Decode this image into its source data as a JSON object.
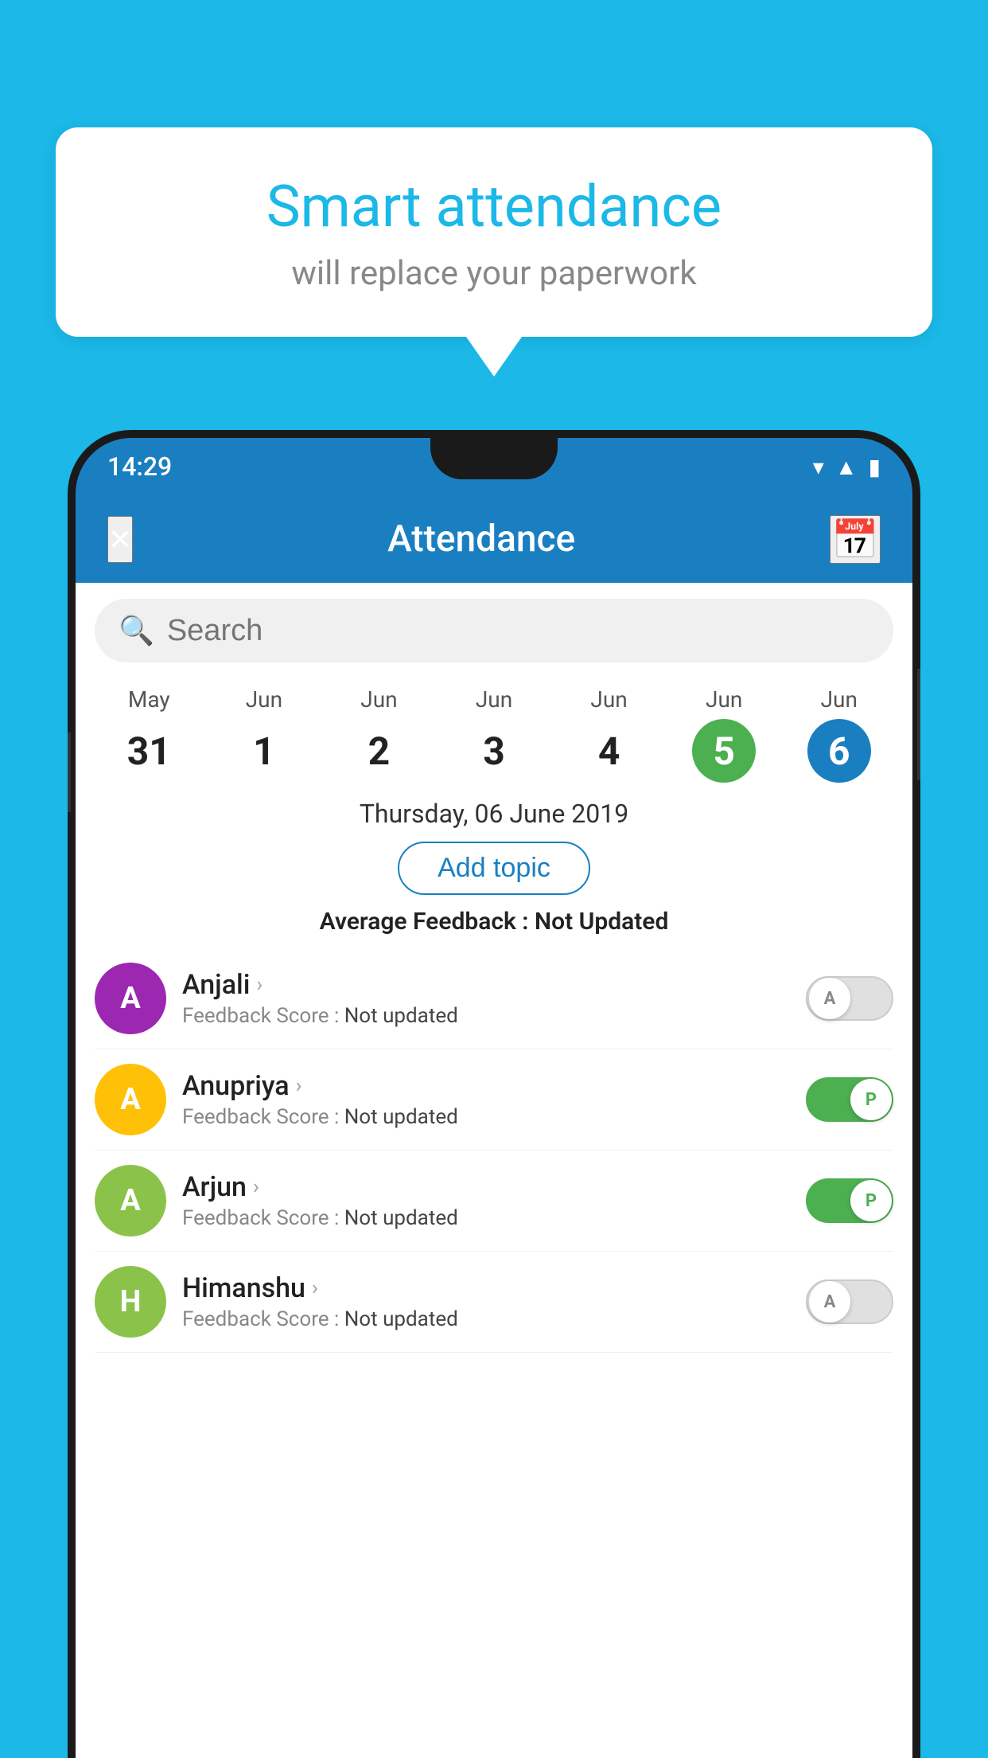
{
  "background_color": "#1bb8e8",
  "speech_bubble": {
    "title": "Smart attendance",
    "subtitle": "will replace your paperwork"
  },
  "status_bar": {
    "time": "14:29",
    "icons": [
      "wifi",
      "signal",
      "battery"
    ]
  },
  "app_bar": {
    "title": "Attendance",
    "close_label": "×",
    "calendar_label": "📅"
  },
  "search": {
    "placeholder": "Search"
  },
  "calendar": {
    "days": [
      {
        "month": "May",
        "date": "31",
        "state": "normal"
      },
      {
        "month": "Jun",
        "date": "1",
        "state": "normal"
      },
      {
        "month": "Jun",
        "date": "2",
        "state": "normal"
      },
      {
        "month": "Jun",
        "date": "3",
        "state": "normal"
      },
      {
        "month": "Jun",
        "date": "4",
        "state": "normal"
      },
      {
        "month": "Jun",
        "date": "5",
        "state": "today"
      },
      {
        "month": "Jun",
        "date": "6",
        "state": "selected"
      }
    ],
    "selected_date_label": "Thursday, 06 June 2019"
  },
  "add_topic_btn": "Add topic",
  "avg_feedback_label": "Average Feedback :",
  "avg_feedback_value": "Not Updated",
  "students": [
    {
      "name": "Anjali",
      "avatar_letter": "A",
      "avatar_color": "#9c27b0",
      "feedback_label": "Feedback Score :",
      "feedback_value": "Not updated",
      "toggle": "off",
      "toggle_letter": "A"
    },
    {
      "name": "Anupriya",
      "avatar_letter": "A",
      "avatar_color": "#ffc107",
      "feedback_label": "Feedback Score :",
      "feedback_value": "Not updated",
      "toggle": "on",
      "toggle_letter": "P"
    },
    {
      "name": "Arjun",
      "avatar_letter": "A",
      "avatar_color": "#8bc34a",
      "feedback_label": "Feedback Score :",
      "feedback_value": "Not updated",
      "toggle": "on",
      "toggle_letter": "P"
    },
    {
      "name": "Himanshu",
      "avatar_letter": "H",
      "avatar_color": "#8bc34a",
      "feedback_label": "Feedback Score :",
      "feedback_value": "Not updated",
      "toggle": "off",
      "toggle_letter": "A"
    }
  ]
}
